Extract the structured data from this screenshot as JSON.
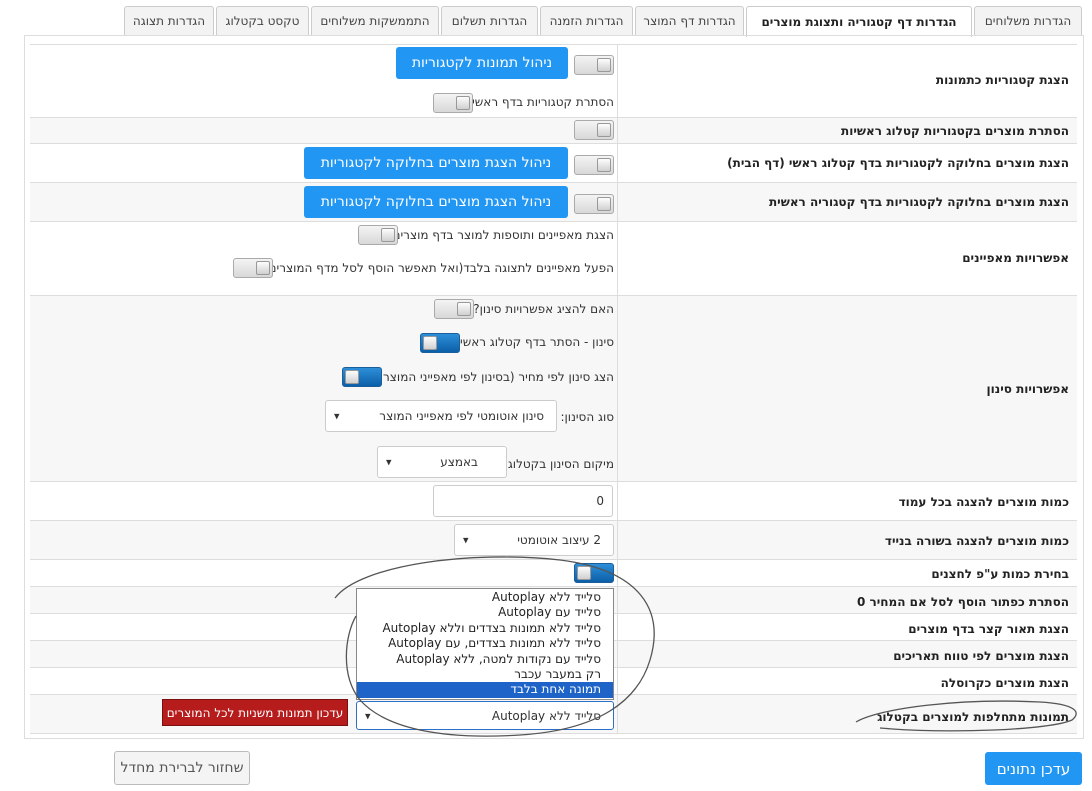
{
  "tabs": [
    {
      "label": "הגדרות משלוחים"
    },
    {
      "label": "הגדרות דף קטגוריה ותצוגת מוצרים"
    },
    {
      "label": "הגדרות דף המוצר"
    },
    {
      "label": "הגדרות הזמנה"
    },
    {
      "label": "הגדרות תשלום"
    },
    {
      "label": "התממשקות משלוחים"
    },
    {
      "label": "טקסט בקטלוג"
    },
    {
      "label": "הגדרות תצוגה"
    }
  ],
  "rows": {
    "category_images": {
      "label": "הצגת קטגוריות כתמונות",
      "button": "ניהול תמונות לקטגוריות",
      "sub_label": "הסתרת קטגוריות בדף ראשי"
    },
    "hide_products_main": {
      "label": "הסתרת מוצרים בקטגוריות קטלוג ראשיות"
    },
    "split_catalog_home": {
      "label": "הצגת מוצרים בחלוקה לקטגוריות בדף קטלוג ראשי (דף הבית)",
      "button": "ניהול הצגת מוצרים בחלוקה לקטגוריות"
    },
    "split_category_main": {
      "label": "הצגת מוצרים בחלוקה לקטגוריות בדף קטגוריה ראשית",
      "button": "ניהול הצגת מוצרים בחלוקה לקטגוריות"
    },
    "features": {
      "label": "אפשרויות מאפיינים",
      "opt1": "הצגת מאפיינים ותוספות למוצר בדף מוצרים",
      "opt2": "הפעל מאפיינים לתצוגה בלבד(ואל תאפשר הוסף לסל מדף המוצרים)"
    },
    "filter": {
      "label": "אפשרויות סינון",
      "opt1": "האם להציג אפשרויות סינון?",
      "opt2": "סינון - הסתר בדף קטלוג ראשי",
      "opt3": "הצג סינון לפי מחיר (בסינון לפי מאפייני המוצר)",
      "type_label": "סוג הסינון:",
      "type_value": "סינון אוטומטי לפי מאפייני המוצר",
      "position_label": "מיקום הסינון בקטלוג",
      "position_value": "באמצע"
    },
    "per_page": {
      "label": "כמות מוצרים להצגה בכל עמוד",
      "value": "0"
    },
    "per_row_mobile": {
      "label": "כמות מוצרים להצגה בשורה בנייד",
      "value": "2 עיצוב אוטומטי"
    },
    "qty_by_clicks": {
      "label": "בחירת כמות ע\"פ לחצנים"
    },
    "hide_add_zero": {
      "label": "הסתרת כפתור הוסף לסל אם המחיר 0"
    },
    "short_desc": {
      "label": "הצגת תאור קצר בדף מוצרים"
    },
    "date_range": {
      "label": "הצגת מוצרים לפי טווח תאריכים"
    },
    "carousel": {
      "label": "הצגת מוצרים כקרוסלה"
    },
    "alt_images": {
      "label": "תמונות מתחלפות למוצרים בקטלוג",
      "value": "סלייד ללא Autoplay",
      "update_button": "עדכון תמונות משניות לכל המוצרים"
    }
  },
  "dropdown_options": [
    "סלייד ללא Autoplay",
    "סלייד עם Autoplay",
    "סלייד ללא תמונות בצדדים וללא Autoplay",
    "סלייד ללא תמונות בצדדים, עם Autoplay",
    "סלייד עם נקודות למטה, ללא Autoplay",
    "רק במעבר עכבר",
    "תמונה אחת בלבד"
  ],
  "selected_option_index": 6,
  "footer": {
    "save": "עדכן נתונים",
    "reset": "שחזור לברירת מחדל"
  },
  "colors": {
    "accent": "#2196f3",
    "danger": "#b71c1c",
    "selected": "#1e64c8"
  }
}
